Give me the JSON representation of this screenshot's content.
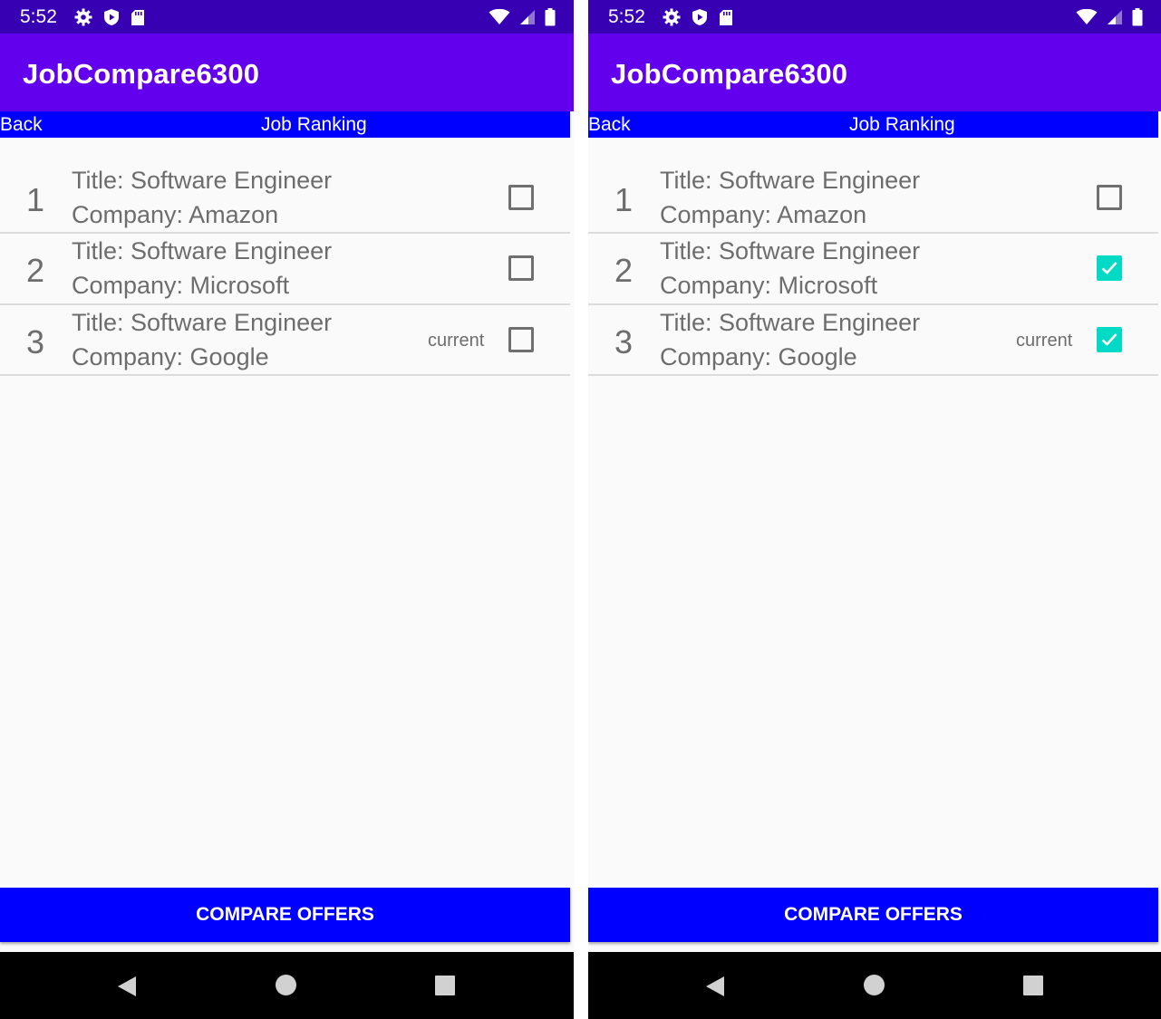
{
  "screens": [
    {
      "status_bar": {
        "time": "5:52",
        "icons_left": [
          "settings-gear-icon",
          "shield-play-icon",
          "sd-card-icon"
        ],
        "icons_right": [
          "wifi-icon",
          "cellular-signal-icon",
          "battery-icon"
        ]
      },
      "app_bar": {
        "title": "JobCompare6300"
      },
      "nav_strip": {
        "back_label": "Back",
        "title": "Job Ranking"
      },
      "jobs": [
        {
          "rank": "1",
          "title": "Title: Software Engineer",
          "company": "Company: Amazon",
          "current": "",
          "checked": false
        },
        {
          "rank": "2",
          "title": "Title: Software Engineer",
          "company": "Company: Microsoft",
          "current": "",
          "checked": false
        },
        {
          "rank": "3",
          "title": "Title: Software Engineer",
          "company": "Company: Google",
          "current": "current",
          "checked": false
        }
      ],
      "compare_button": "COMPARE OFFERS"
    },
    {
      "status_bar": {
        "time": "5:52",
        "icons_left": [
          "settings-gear-icon",
          "shield-play-icon",
          "sd-card-icon"
        ],
        "icons_right": [
          "wifi-icon",
          "cellular-signal-icon",
          "battery-icon"
        ]
      },
      "app_bar": {
        "title": "JobCompare6300"
      },
      "nav_strip": {
        "back_label": "Back",
        "title": "Job Ranking"
      },
      "jobs": [
        {
          "rank": "1",
          "title": "Title: Software Engineer",
          "company": "Company: Amazon",
          "current": "",
          "checked": false
        },
        {
          "rank": "2",
          "title": "Title: Software Engineer",
          "company": "Company: Microsoft",
          "current": "",
          "checked": true
        },
        {
          "rank": "3",
          "title": "Title: Software Engineer",
          "company": "Company: Google",
          "current": "current",
          "checked": true
        }
      ],
      "compare_button": "COMPARE OFFERS"
    }
  ],
  "colors": {
    "status_bar": "#3700b3",
    "app_bar": "#6200ee",
    "nav_strip": "#0000ff",
    "checkbox_checked": "#03dac5",
    "text_gray": "#6d6d6d"
  }
}
